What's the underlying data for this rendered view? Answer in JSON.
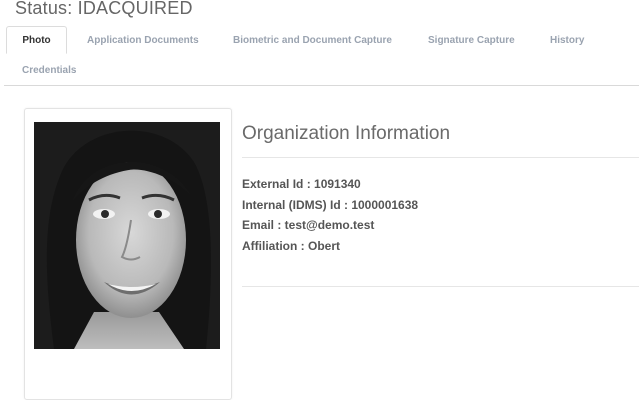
{
  "status": "Status: IDACQUIRED",
  "tabs": [
    {
      "label": "Photo",
      "active": true
    },
    {
      "label": "Application Documents",
      "active": false
    },
    {
      "label": "Biometric and Document Capture",
      "active": false
    },
    {
      "label": "Signature Capture",
      "active": false
    },
    {
      "label": "History",
      "active": false
    },
    {
      "label": "Credentials",
      "active": false
    }
  ],
  "organization": {
    "title": "Organization Information",
    "external_id": "External Id : 1091340",
    "internal_id": "Internal (IDMS) Id : 1000001638",
    "email": "Email : test@demo.test",
    "affiliation": "Affiliation : Obert"
  },
  "photo": {
    "description_icon": "portrait-photo"
  }
}
